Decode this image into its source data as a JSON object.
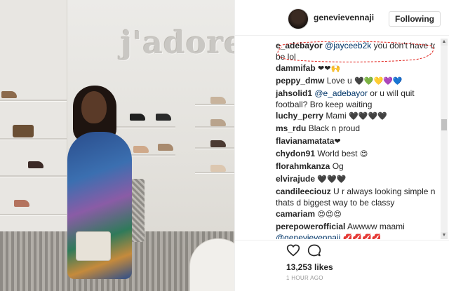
{
  "profile": {
    "username": "genevievennaji",
    "follow_label": "Following"
  },
  "comments": [
    {
      "user": "e_adebayor",
      "mention": "@jayceeb2k",
      "text": "you don't have to be lol"
    },
    {
      "user": "dammifab",
      "emoji": "❤❤🙌"
    },
    {
      "user": "peppy_dmw",
      "text": "Love u",
      "emoji": "🖤💚💛💜💙"
    },
    {
      "user": "jahsolid1",
      "mention": "@e_adebayor",
      "text": "or u will quit football? Bro keep waiting"
    },
    {
      "user": "luchy_perry",
      "text": "Mami",
      "emoji": "🖤🖤🖤🖤"
    },
    {
      "user": "ms_rdu",
      "text": "Black n proud"
    },
    {
      "user": "flavianamatata",
      "emoji": "❤"
    },
    {
      "user": "chydon91",
      "text": "World best",
      "emoji": "😍"
    },
    {
      "user": "florahmkanza",
      "text": "Og"
    },
    {
      "user": "elvirajude",
      "emoji": "🖤🖤🖤"
    },
    {
      "user": "candileeciouz",
      "text": "U r always looking simple n thats d biggest way to be classy"
    },
    {
      "user": "camariam",
      "emoji": "😍😍😍"
    },
    {
      "user": "perepowerofficial",
      "text": "Awwww maami",
      "mention": "@genevievennaji",
      "emoji": "💋💋💋💋"
    }
  ],
  "icons": {
    "heart": "heart-icon",
    "comment": "comment-icon"
  },
  "likes_label": "13,253 likes",
  "timestamp": "1 HOUR AGO",
  "photo": {
    "brand_text": "j'adore"
  },
  "colors": {
    "annotation": "#e0201a",
    "mention": "#003569",
    "button_border": "#dbdbdb"
  }
}
